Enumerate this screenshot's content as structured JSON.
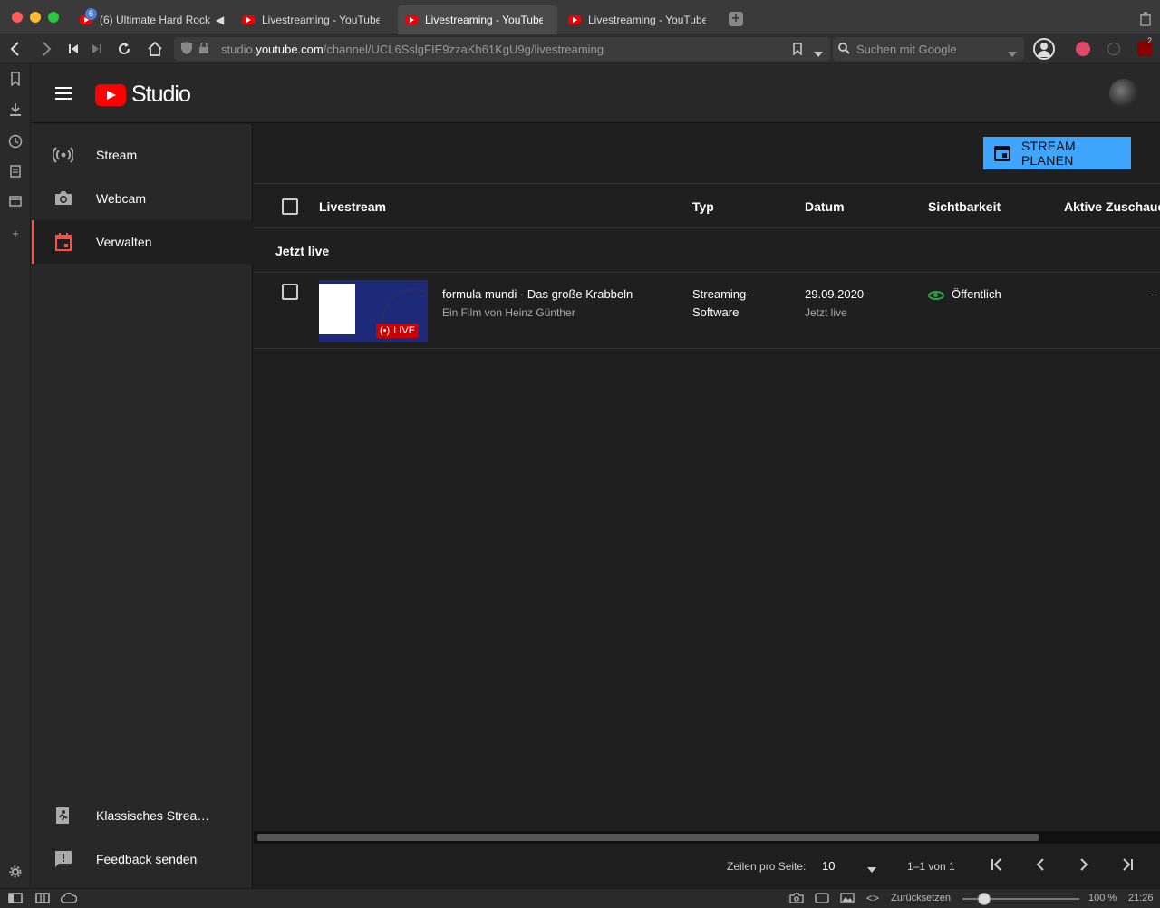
{
  "browser": {
    "tabs": [
      {
        "title": "(6) Ultimate Hard Rock",
        "badge": "6"
      },
      {
        "title": "Livestreaming - YouTube St"
      },
      {
        "title": "Livestreaming - YouTube St"
      },
      {
        "title": "Livestreaming - YouTube St"
      }
    ],
    "url_prefix": "studio.",
    "url_host": "youtube.com",
    "url_path": "/channel/UCL6SslgFIE9zzaKh61KgU9g/livestreaming",
    "search_placeholder": "Suchen mit Google",
    "ext_badge": "2",
    "status": {
      "reset": "Zurücksetzen",
      "zoom": "100 %",
      "time": "21:26"
    }
  },
  "studio": {
    "logo_text": "Studio",
    "nav": [
      {
        "label": "Stream",
        "icon": "broadcast-icon"
      },
      {
        "label": "Webcam",
        "icon": "camera-icon"
      },
      {
        "label": "Verwalten",
        "icon": "calendar-icon",
        "active": true
      }
    ],
    "bottom_nav": [
      {
        "label": "Klassisches Strea…",
        "icon": "exit-icon"
      },
      {
        "label": "Feedback senden",
        "icon": "feedback-icon"
      }
    ],
    "plan_button": "STREAM PLANEN",
    "columns": {
      "livestream": "Livestream",
      "type": "Typ",
      "date": "Datum",
      "visibility": "Sichtbarkeit",
      "viewers": "Aktive Zuschaue"
    },
    "section": "Jetzt live",
    "rows": [
      {
        "title": "formula mundi - Das große Krabbeln",
        "description": "Ein Film von Heinz Günther",
        "live_label": "LIVE",
        "type_line1": "Streaming-",
        "type_line2": "Software",
        "date": "29.09.2020",
        "date_sub": "Jetzt live",
        "visibility": "Öffentlich",
        "viewers": "–"
      }
    ],
    "pager": {
      "rows_per_page_label": "Zeilen pro Seite:",
      "rows_per_page": "10",
      "range": "1–1 von 1"
    }
  }
}
